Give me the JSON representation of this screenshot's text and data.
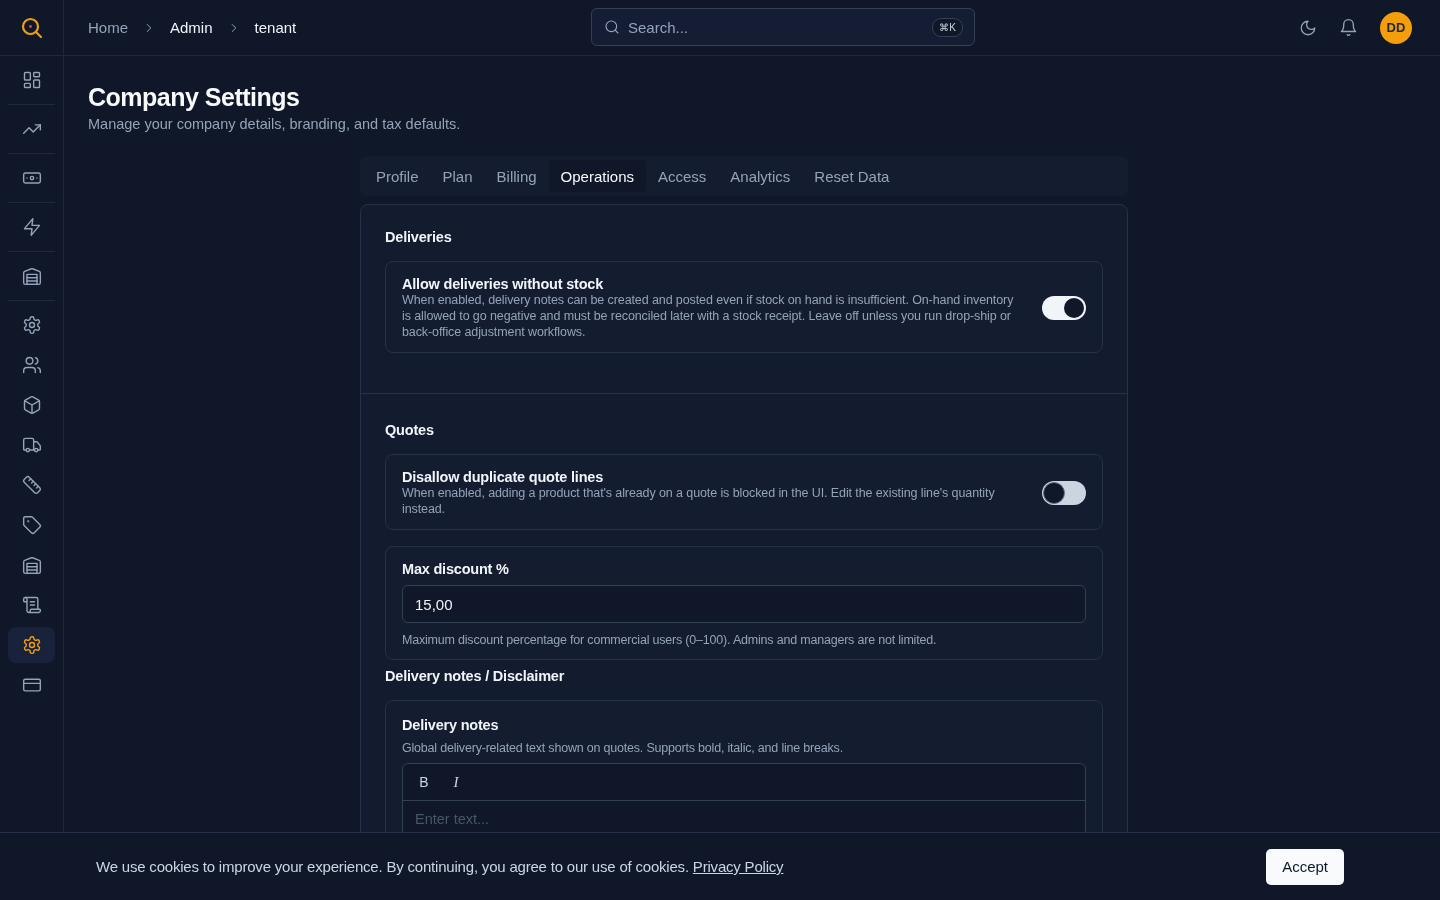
{
  "header": {
    "breadcrumbs": [
      {
        "label": "Home",
        "muted": true
      },
      {
        "label": "Admin",
        "muted": false
      },
      {
        "label": "tenant",
        "muted": false
      }
    ],
    "search": {
      "placeholder": "Search...",
      "shortcut": "⌘K"
    },
    "avatar": "DD"
  },
  "sidebar": {
    "groups": [
      {
        "items": [
          {
            "selected": false
          }
        ]
      },
      {
        "items": [
          {
            "selected": false
          }
        ]
      },
      {
        "items": [
          {
            "selected": false
          }
        ]
      },
      {
        "items": [
          {
            "selected": false
          }
        ]
      },
      {
        "items": [
          {
            "selected": false
          }
        ]
      },
      {
        "items": [
          {
            "selected": false
          },
          {
            "selected": false
          },
          {
            "selected": false
          },
          {
            "selected": false
          },
          {
            "selected": false
          },
          {
            "selected": false
          },
          {
            "selected": false
          },
          {
            "selected": false
          },
          {
            "selected": true
          },
          {
            "selected": false
          }
        ]
      }
    ]
  },
  "page": {
    "title": "Company Settings",
    "subtitle": "Manage your company details, branding, and tax defaults."
  },
  "tabs": [
    {
      "label": "Profile",
      "selected": false
    },
    {
      "label": "Plan",
      "selected": false
    },
    {
      "label": "Billing",
      "selected": false
    },
    {
      "label": "Operations",
      "selected": true
    },
    {
      "label": "Access",
      "selected": false
    },
    {
      "label": "Analytics",
      "selected": false
    },
    {
      "label": "Reset Data",
      "selected": false
    }
  ],
  "groups": [
    {
      "sections": [
        {
          "title": "Deliveries",
          "items": [
            {
              "kind": "toggle",
              "label": "Allow deliveries without stock",
              "description": "When enabled, delivery notes can be created and posted even if stock on hand is insufficient. On-hand inventory is allowed to go negative and must be reconciled later with a stock receipt. Leave off unless you run drop-ship or back-office adjustment workflows.",
              "on": true
            }
          ]
        }
      ]
    },
    {
      "sections": [
        {
          "title": "Quotes",
          "items": [
            {
              "kind": "toggle",
              "label": "Disallow duplicate quote lines",
              "description": "When enabled, adding a product that's already on a quote is blocked in the UI. Edit the existing line's quantity instead.",
              "on": false
            },
            {
              "kind": "number",
              "label": "Max discount %",
              "value": "15,00",
              "help": "Maximum discount percentage for commercial users (0–100). Admins and managers are not limited."
            }
          ]
        },
        {
          "title": "Delivery notes / Disclaimer",
          "items": [
            {
              "kind": "editor",
              "label": "Delivery notes",
              "description": "Global delivery-related text shown on quotes. Supports bold, italic, and line breaks.",
              "toolbar": [
                "B",
                "I"
              ],
              "placeholder": "Enter text..."
            }
          ]
        }
      ]
    }
  ],
  "cookie_banner": {
    "text": "We use cookies to improve your experience. By continuing, you agree to our use of cookies.",
    "link": "Privacy Policy",
    "button": "Accept"
  }
}
